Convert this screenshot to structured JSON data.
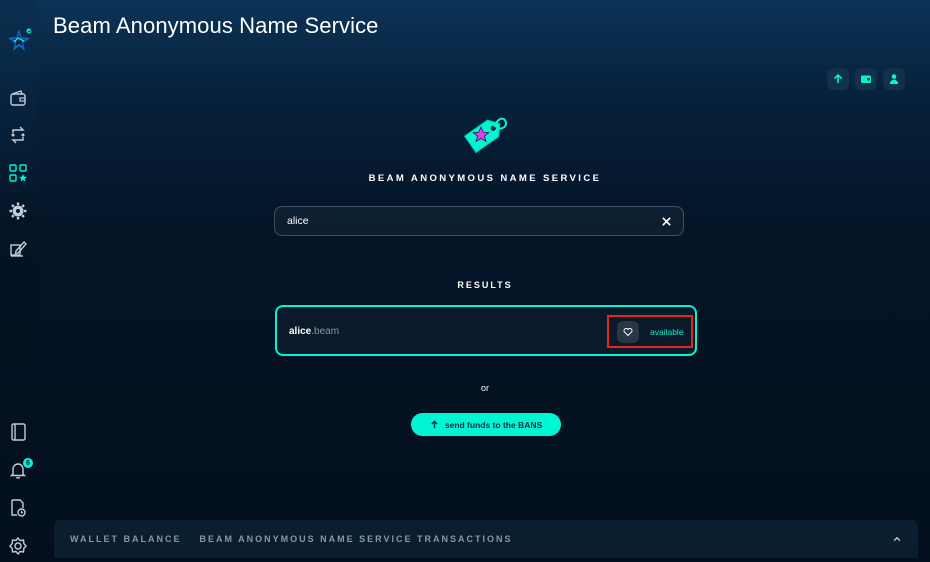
{
  "app": {
    "title": "Beam Anonymous Name Service"
  },
  "sidebar": {
    "items": [
      {
        "icon": "wallet-icon"
      },
      {
        "icon": "transactions-icon"
      },
      {
        "icon": "dapps-icon",
        "active": true
      },
      {
        "icon": "gear-icon"
      },
      {
        "icon": "edit-icon"
      },
      {
        "icon": "notebook-icon"
      },
      {
        "icon": "bell-icon"
      },
      {
        "icon": "document-clock-icon"
      },
      {
        "icon": "settings-icon"
      }
    ],
    "notification_count": "6"
  },
  "top_actions": [
    {
      "icon": "arrow-up-icon"
    },
    {
      "icon": "wallet-icon"
    },
    {
      "icon": "user-icon"
    }
  ],
  "hero": {
    "title": "BEAM ANONYMOUS NAME SERVICE"
  },
  "search": {
    "value": "alice",
    "placeholder": ""
  },
  "results": {
    "title": "RESULTS",
    "items": [
      {
        "name": "alice",
        "suffix": ".beam",
        "status": "available"
      }
    ]
  },
  "or_label": "or",
  "send_button": {
    "label": "send funds to the BANS"
  },
  "bottom_bar": {
    "tabs": [
      "WALLET BALANCE",
      "BEAM ANONYMOUS NAME SERVICE TRANSACTIONS"
    ]
  },
  "colors": {
    "accent": "#00f6d2",
    "highlight": "#e0281d",
    "background": "#041224"
  }
}
